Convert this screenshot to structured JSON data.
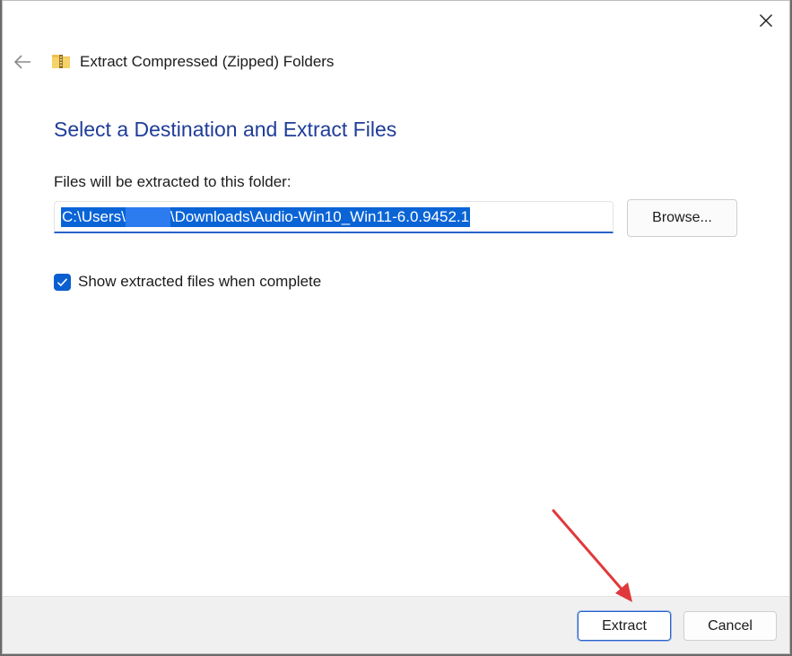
{
  "window": {
    "title": "Extract Compressed (Zipped) Folders",
    "icon": "zip-folder-icon"
  },
  "main": {
    "heading": "Select a Destination and Extract Files",
    "destination_label": "Files will be extracted to this folder:",
    "path_prefix": "C:\\Users\\",
    "path_suffix": "\\Downloads\\Audio-Win10_Win11-6.0.9452.1",
    "browse_label": "Browse...",
    "show_files_label": "Show extracted files when complete",
    "show_files_checked": true
  },
  "footer": {
    "extract_label": "Extract",
    "cancel_label": "Cancel"
  },
  "colors": {
    "heading": "#1f3d99",
    "accent": "#0a5fd0",
    "annotation_arrow": "#e0393b"
  }
}
